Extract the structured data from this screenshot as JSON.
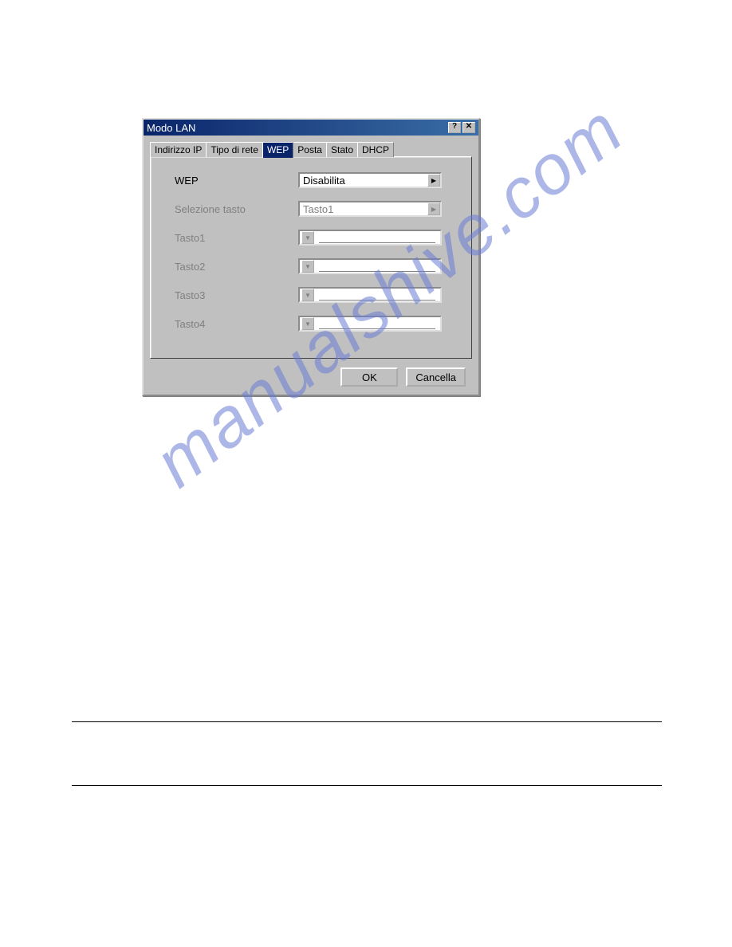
{
  "dialog": {
    "title": "Modo LAN",
    "help_label": "?",
    "close_label": "✕"
  },
  "tabs": [
    {
      "label": "Indirizzo IP",
      "active": false
    },
    {
      "label": "Tipo di rete",
      "active": false
    },
    {
      "label": "WEP",
      "active": true
    },
    {
      "label": "Posta",
      "active": false
    },
    {
      "label": "Stato",
      "active": false
    },
    {
      "label": "DHCP",
      "active": false
    }
  ],
  "form": {
    "wep_label": "WEP",
    "wep_value": "Disabilita",
    "selection_label": "Selezione tasto",
    "selection_value": "Tasto1",
    "key1_label": "Tasto1",
    "key2_label": "Tasto2",
    "key3_label": "Tasto3",
    "key4_label": "Tasto4"
  },
  "buttons": {
    "ok": "OK",
    "cancel": "Cancella"
  },
  "watermark": "manualshive.com"
}
